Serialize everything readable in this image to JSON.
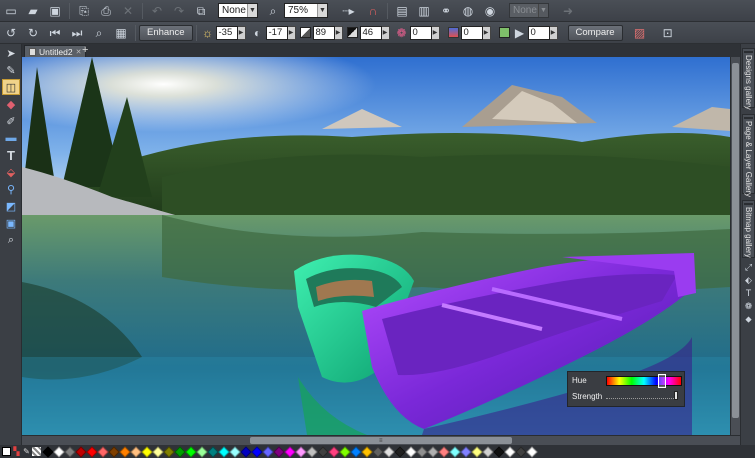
{
  "toolbar_top": {
    "icons": [
      "new-icon",
      "open-icon",
      "save-icon",
      "import-icon",
      "export-icon",
      "delete-icon",
      "undo-icon",
      "redo-icon",
      "resize-icon",
      "copy-icon",
      "paste-icon"
    ],
    "quality_select": "None",
    "zoom_select": "75%",
    "disabled_select": "None"
  },
  "toolbar_photo": {
    "enhance_label": "Enhance",
    "brightness": "-35",
    "contrast": "-17",
    "saturation": "89",
    "sharpen": "46",
    "temperature": "0",
    "tint": "0",
    "blur": "0",
    "compare_label": "Compare"
  },
  "tabs": {
    "doc_tab": "Untitled2",
    "new_tab": "+"
  },
  "galleries": {
    "designs": "Designs gallery",
    "page_layer": "Page & Layer Gallery",
    "bitmap": "Bitmap gallery"
  },
  "hue_panel": {
    "hue_label": "Hue",
    "strength_label": "Strength",
    "hue_position": 0.72,
    "strength_value": 1.0
  },
  "palette": {
    "colors": [
      "#000000",
      "#ffffff",
      "#7f7f7f",
      "#c00000",
      "#ff0000",
      "#ff6666",
      "#7f3f00",
      "#ff8000",
      "#ffbf80",
      "#ffff00",
      "#ffff99",
      "#808000",
      "#00a000",
      "#00ff00",
      "#99ff99",
      "#008080",
      "#00ffff",
      "#99ffff",
      "#0000c0",
      "#0000ff",
      "#6666ff",
      "#800080",
      "#ff00ff",
      "#ff99ff",
      "#c0c0c0",
      "#404040",
      "#ff4080",
      "#80ff00",
      "#0080ff",
      "#ffc000",
      "#606060",
      "#e0e0e0",
      "#202020",
      "#ffffff",
      "#909090",
      "#b0b0b0",
      "#ff8080",
      "#80ffff",
      "#8080ff",
      "#ffff80",
      "#d0d0d0",
      "#101010",
      "#ffffff",
      "#404040",
      "#ffffff"
    ]
  }
}
